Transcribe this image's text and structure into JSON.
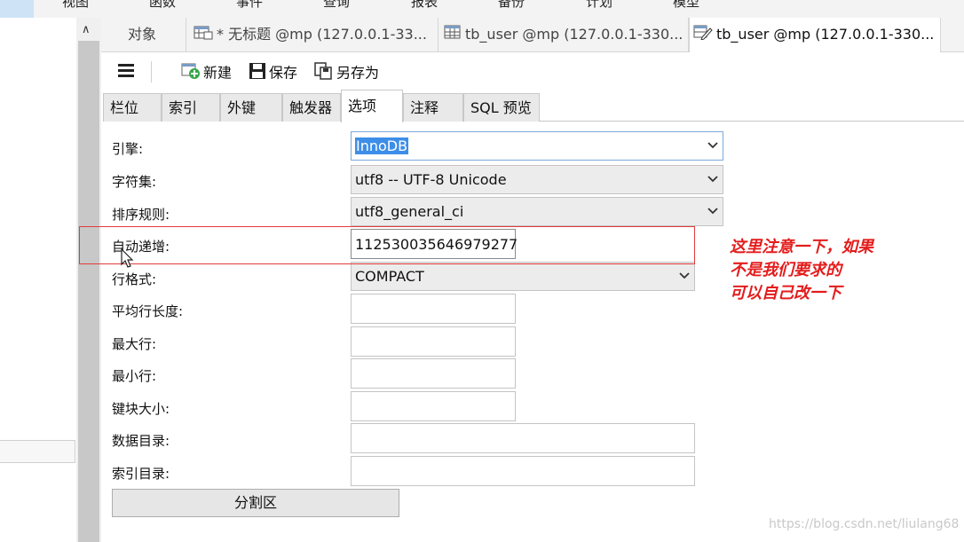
{
  "menu": [
    "视图",
    "函数",
    "事件",
    "查询",
    "报表",
    "备份",
    "计划",
    "模型"
  ],
  "tabs": [
    {
      "label": "对象"
    },
    {
      "label": "* 无标题 @mp (127.0.0.1-33..."
    },
    {
      "label": "tb_user @mp (127.0.0.1-330..."
    },
    {
      "label": "tb_user @mp (127.0.0.1-330..."
    }
  ],
  "toolbar": {
    "new": "新建",
    "save": "保存",
    "save_as": "另存为"
  },
  "subtabs": [
    "栏位",
    "索引",
    "外键",
    "触发器",
    "选项",
    "注释",
    "SQL 预览"
  ],
  "form": {
    "engine": {
      "label": "引擎:",
      "value": "InnoDB"
    },
    "charset": {
      "label": "字符集:",
      "value": "utf8 -- UTF-8 Unicode"
    },
    "collation": {
      "label": "排序规则:",
      "value": "utf8_general_ci"
    },
    "auto_increment": {
      "label": "自动递增:",
      "value": "112530035646979277"
    },
    "row_format": {
      "label": "行格式:",
      "value": "COMPACT"
    },
    "avg_row_length": {
      "label": "平均行长度:",
      "value": ""
    },
    "max_rows": {
      "label": "最大行:",
      "value": ""
    },
    "min_rows": {
      "label": "最小行:",
      "value": ""
    },
    "key_block_size": {
      "label": "键块大小:",
      "value": ""
    },
    "data_directory": {
      "label": "数据目录:",
      "value": ""
    },
    "index_directory": {
      "label": "索引目录:",
      "value": ""
    },
    "partition_button": "分割区"
  },
  "annotation": [
    "这里注意一下，如果",
    "不是我们要求的",
    "可以自己改一下"
  ],
  "watermark": "https://blog.csdn.net/liulang68",
  "colors": {
    "highlight": "#3d8ee8",
    "annotation": "#e41c1c",
    "redbox": "#e23b3b"
  }
}
